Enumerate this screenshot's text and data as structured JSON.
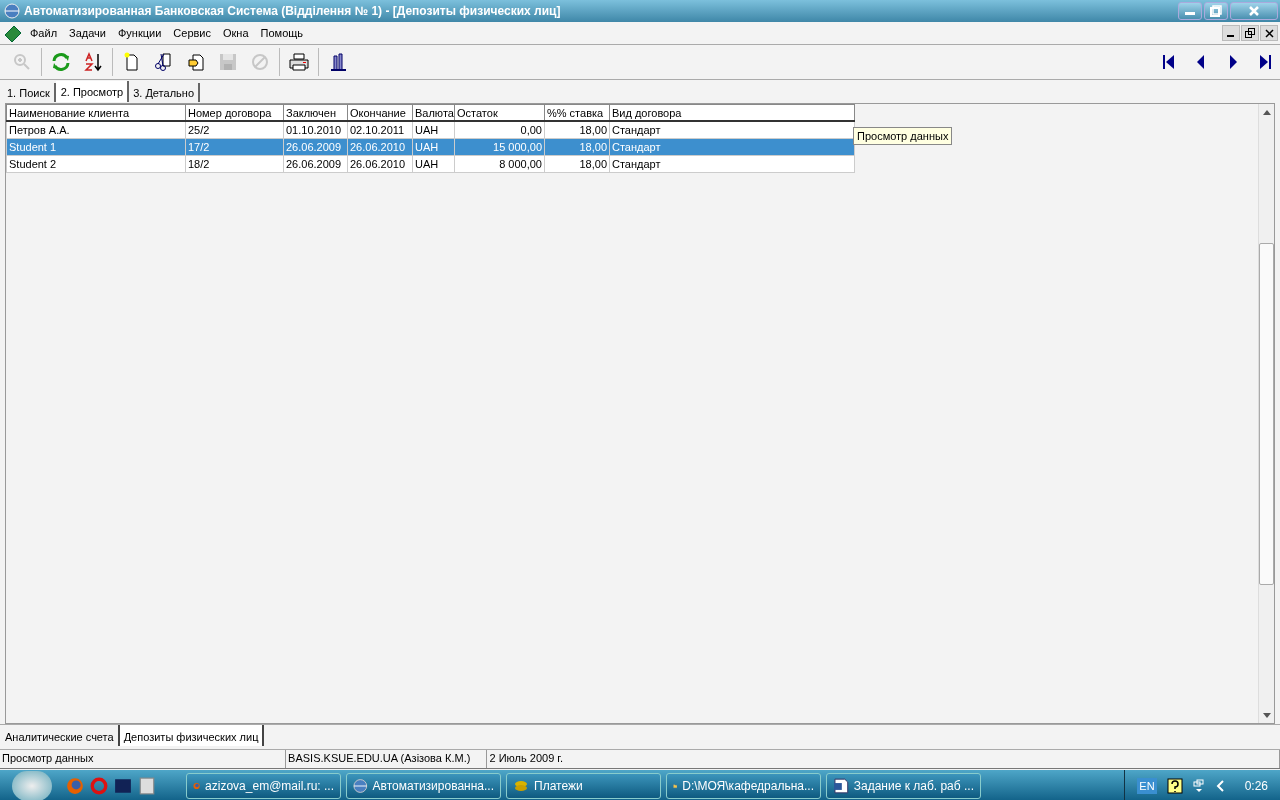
{
  "window": {
    "title": "Автоматизированная Банковская Система (Відділення № 1) - [Депозиты физических лиц]"
  },
  "menu": [
    "Файл",
    "Задачи",
    "Функции",
    "Сервис",
    "Окна",
    "Помощь"
  ],
  "toolbar": [
    {
      "kind": "zoom",
      "disabled": true
    },
    {
      "kind": "refresh",
      "disabled": false
    },
    {
      "kind": "sort",
      "disabled": false
    },
    {
      "kind": "new",
      "disabled": false
    },
    {
      "kind": "cut",
      "disabled": false
    },
    {
      "kind": "edit",
      "disabled": false
    },
    {
      "kind": "save",
      "disabled": true
    },
    {
      "kind": "cancel",
      "disabled": true
    },
    {
      "kind": "print",
      "disabled": false
    },
    {
      "kind": "tool",
      "disabled": false
    }
  ],
  "tabs": [
    {
      "label": "1. Поиск",
      "selected": false
    },
    {
      "label": "2. Просмотр",
      "selected": true
    },
    {
      "label": "3. Детально",
      "selected": false
    }
  ],
  "table": {
    "columns": [
      "Наименование клиента",
      "Номер договора",
      "Заключен",
      "Окончание",
      "Валюта",
      "Остаток",
      "%% ставка",
      "Вид договора"
    ],
    "rows": [
      {
        "cells": [
          "Петров А.А.",
          "25/2",
          "01.10.2010",
          "02.10.2011",
          "UAH",
          "0,00",
          "18,00",
          "Стандарт"
        ],
        "selected": false
      },
      {
        "cells": [
          "Student 1",
          "17/2",
          "26.06.2009",
          "26.06.2010",
          "UAH",
          "15 000,00",
          "18,00",
          "Стандарт"
        ],
        "selected": true
      },
      {
        "cells": [
          "Student 2",
          "18/2",
          "26.06.2009",
          "26.06.2010",
          "UAH",
          "8 000,00",
          "18,00",
          "Стандарт"
        ],
        "selected": false
      }
    ]
  },
  "tooltip": "Просмотр данных",
  "window_tabs": [
    {
      "label": "Аналитические счета",
      "selected": false
    },
    {
      "label": "Депозиты физических лиц",
      "selected": true
    }
  ],
  "status_bar": [
    "Просмотр данных",
    "BASIS.KSUE.EDU.UA (Азізова К.М.)",
    "2 Июль 2009 г."
  ],
  "taskbar": {
    "tasks": [
      {
        "label": "azizova_em@mail.ru: ...",
        "kind": "firefox"
      },
      {
        "label": "Автоматизированна...",
        "kind": "globe"
      },
      {
        "label": "Платежи",
        "kind": "coins"
      },
      {
        "label": "D:\\МОЯ\\кафедральна...",
        "kind": "folder"
      },
      {
        "label": "Задание к лаб. раб ...",
        "kind": "word"
      }
    ],
    "language": "EN",
    "clock": "0:26"
  }
}
